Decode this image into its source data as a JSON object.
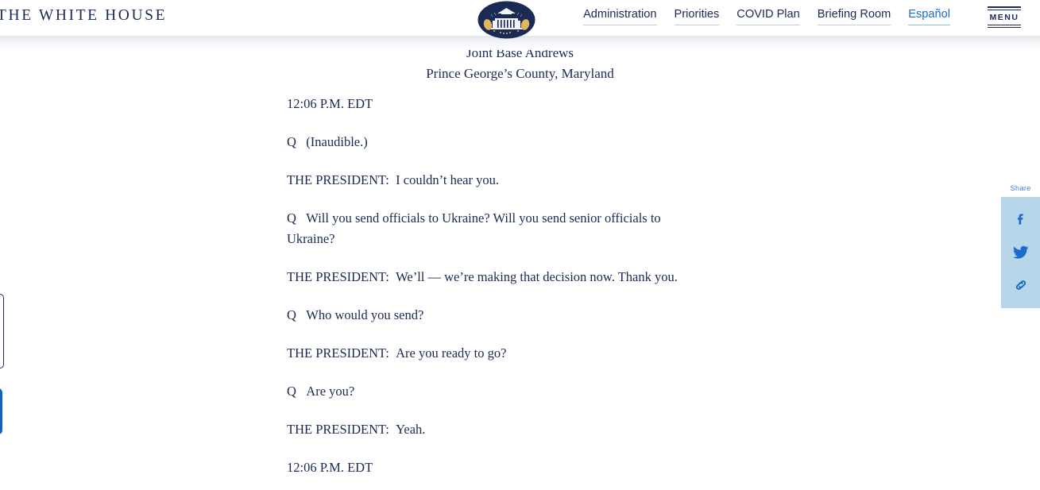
{
  "header": {
    "brand": "THE WHITE HOUSE",
    "seal_icon": "white-house-seal",
    "nav": [
      {
        "label": "Administration",
        "accent": false
      },
      {
        "label": "Priorities",
        "accent": false
      },
      {
        "label": "COVID Plan",
        "accent": false
      },
      {
        "label": "Briefing Room",
        "accent": false
      },
      {
        "label": "Español",
        "accent": true
      }
    ],
    "menu_label": "MENU"
  },
  "dateline": {
    "line1": "Joint Base Andrews",
    "line2": "Prince George’s County, Maryland"
  },
  "transcript": {
    "start_time": "12:06 P.M. EDT",
    "end_time": "12:06 P.M. EDT",
    "entries": [
      {
        "speaker": "Q",
        "gap": "   ",
        "text": "(Inaudible.)"
      },
      {
        "speaker": "THE PRESIDENT:",
        "gap": "  ",
        "text": "I couldn’t hear you."
      },
      {
        "speaker": "Q",
        "gap": "   ",
        "text": "Will you send officials to Ukraine?  Will you send senior officials to Ukraine?"
      },
      {
        "speaker": "THE PRESIDENT:",
        "gap": "  ",
        "text": "We’ll — we’re making that decision now.  Thank you."
      },
      {
        "speaker": "Q",
        "gap": "   ",
        "text": "Who would you send?"
      },
      {
        "speaker": "THE PRESIDENT:",
        "gap": "  ",
        "text": "Are you ready to go?"
      },
      {
        "speaker": "Q",
        "gap": "   ",
        "text": "Are you?"
      },
      {
        "speaker": "THE PRESIDENT:",
        "gap": "  ",
        "text": "Yeah."
      }
    ]
  },
  "share": {
    "label": "Share",
    "items": [
      {
        "icon": "facebook-icon"
      },
      {
        "icon": "twitter-icon"
      },
      {
        "icon": "link-icon"
      }
    ],
    "panel_color": "#b7d6ea",
    "icon_color": "#1a6cc9"
  },
  "colors": {
    "navy": "#1b2a54",
    "link_blue": "#1a6cc9",
    "solid_blue": "#0b63c5"
  }
}
